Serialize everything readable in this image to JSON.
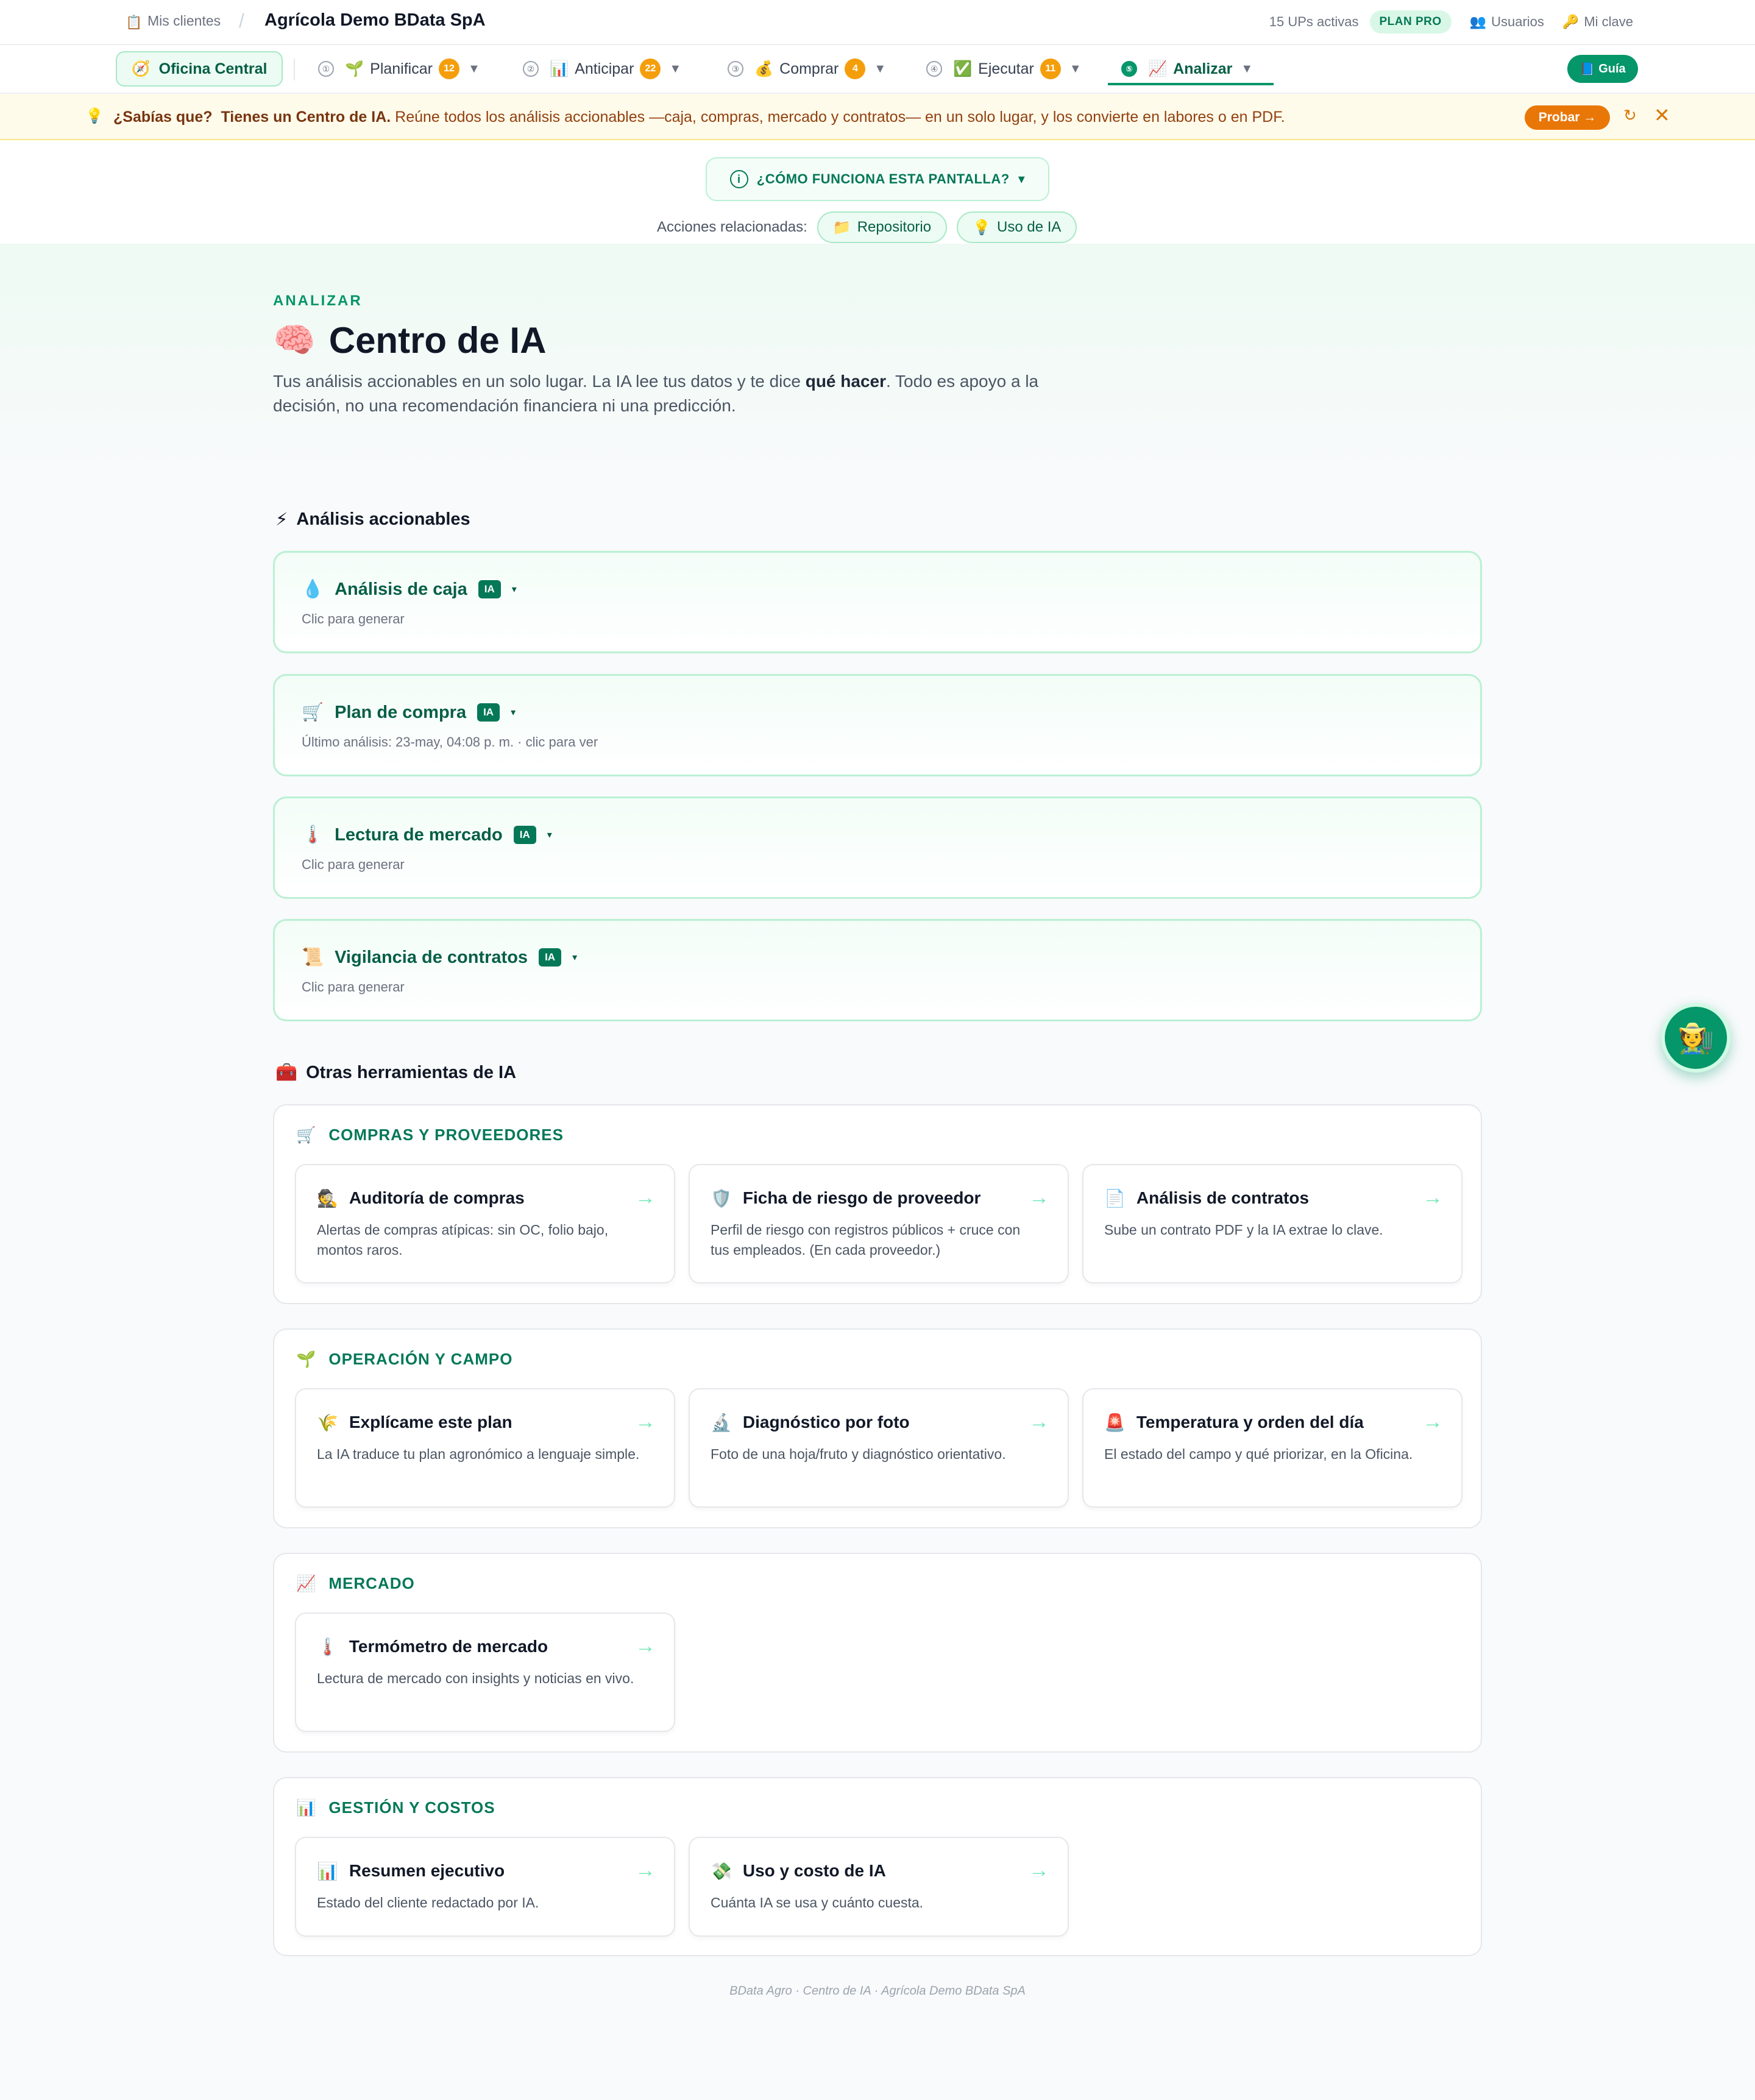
{
  "topbar": {
    "crumb_icon": "📋",
    "crumb_link": "Mis clientes",
    "crumb_sep": "/",
    "client_name": "Agrícola Demo BData SpA",
    "ups": "15 UPs activas",
    "plan": "PLAN PRO",
    "users_icon": "👥",
    "users": "Usuarios",
    "key_icon": "🔑",
    "key": "Mi clave"
  },
  "nav": {
    "home_icon": "🧭",
    "home": "Oficina Central",
    "items": [
      {
        "step": "①",
        "icon": "🌱",
        "label": "Planificar",
        "count": "12"
      },
      {
        "step": "②",
        "icon": "📊",
        "label": "Anticipar",
        "count": "22"
      },
      {
        "step": "③",
        "icon": "💰",
        "label": "Comprar",
        "count": "4"
      },
      {
        "step": "④",
        "icon": "✅",
        "label": "Ejecutar",
        "count": "11"
      },
      {
        "step": "⑤",
        "icon": "📈",
        "label": "Analizar",
        "count": ""
      }
    ],
    "caret": "▼",
    "guide_icon": "📘",
    "guide": "Guía"
  },
  "tip": {
    "icon": "💡",
    "lead": "¿Sabías que?",
    "bold": "Tienes un Centro de IA.",
    "text": "Reúne todos los análisis accionables —caja, compras, mercado y contratos— en un solo lugar, y los convierte en labores o en PDF.",
    "try": "Probar →",
    "refresh": "↻",
    "close": "✕"
  },
  "help": {
    "info": "i",
    "how": "¿CÓMO FUNCIONA ESTA PANTALLA?",
    "how_caret": "▾",
    "related_label": "Acciones relacionadas:",
    "related": [
      {
        "icon": "📁",
        "label": "Repositorio"
      },
      {
        "icon": "💡",
        "label": "Uso de IA"
      }
    ]
  },
  "hero": {
    "eyebrow": "ANALIZAR",
    "emoji": "🧠",
    "title": "Centro de IA",
    "desc_1": "Tus análisis accionables en un solo lugar. La IA lee tus datos y te dice ",
    "desc_bold": "qué hacer",
    "desc_2": ". Todo es apoyo a la decisión, no una recomendación financiera ni una predicción."
  },
  "actionable": {
    "icon": "⚡",
    "title": "Análisis accionables",
    "badge": "IA",
    "caret": "▾",
    "items": [
      {
        "icon": "💧",
        "title": "Análisis de caja",
        "sub": "Clic para generar"
      },
      {
        "icon": "🛒",
        "title": "Plan de compra",
        "sub": "Último análisis: 23-may, 04:08 p. m. · clic para ver"
      },
      {
        "icon": "🌡️",
        "title": "Lectura de mercado",
        "sub": "Clic para generar"
      },
      {
        "icon": "📜",
        "title": "Vigilancia de contratos",
        "sub": "Clic para generar"
      }
    ]
  },
  "tools": {
    "icon": "🧰",
    "title": "Otras herramientas de IA",
    "arrow": "→",
    "groups": [
      {
        "icon": "🛒",
        "title": "COMPRAS Y PROVEEDORES",
        "items": [
          {
            "icon": "🕵️",
            "title": "Auditoría de compras",
            "desc": "Alertas de compras atípicas: sin OC, folio bajo, montos raros."
          },
          {
            "icon": "🛡️",
            "title": "Ficha de riesgo de proveedor",
            "desc": "Perfil de riesgo con registros públicos + cruce con tus empleados. (En cada proveedor.)"
          },
          {
            "icon": "📄",
            "title": "Análisis de contratos",
            "desc": "Sube un contrato PDF y la IA extrae lo clave."
          }
        ]
      },
      {
        "icon": "🌱",
        "title": "OPERACIÓN Y CAMPO",
        "items": [
          {
            "icon": "🌾",
            "title": "Explícame este plan",
            "desc": "La IA traduce tu plan agronómico a lenguaje simple."
          },
          {
            "icon": "🔬",
            "title": "Diagnóstico por foto",
            "desc": "Foto de una hoja/fruto y diagnóstico orientativo."
          },
          {
            "icon": "🚨",
            "title": "Temperatura y orden del día",
            "desc": "El estado del campo y qué priorizar, en la Oficina."
          }
        ]
      },
      {
        "icon": "📈",
        "title": "MERCADO",
        "items": [
          {
            "icon": "🌡️",
            "title": "Termómetro de mercado",
            "desc": "Lectura de mercado con insights y noticias en vivo."
          }
        ]
      },
      {
        "icon": "📊",
        "title": "GESTIÓN Y COSTOS",
        "items": [
          {
            "icon": "📊",
            "title": "Resumen ejecutivo",
            "desc": "Estado del cliente redactado por IA."
          },
          {
            "icon": "💸",
            "title": "Uso y costo de IA",
            "desc": "Cuánta IA se usa y cuánto cuesta."
          }
        ]
      }
    ]
  },
  "footer": "BData Agro · Centro de IA · Agrícola Demo BData SpA",
  "fab_icon": "🧑‍🌾"
}
